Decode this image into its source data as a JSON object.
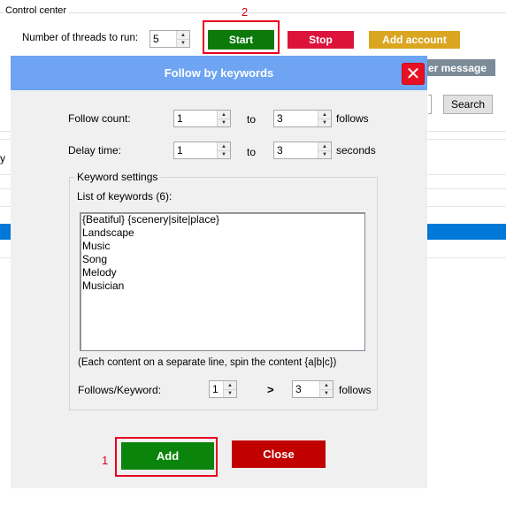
{
  "control_center": {
    "title": "Control center",
    "threads_label": "Number of threads to run:",
    "threads_value": "5",
    "start_label": "Start",
    "stop_label": "Stop",
    "add_account_label": "Add account",
    "message_button_label": "er message",
    "search_label": "Search",
    "background_fragment": "y"
  },
  "annotations": {
    "step_2": "2",
    "step_1": "1"
  },
  "dialog": {
    "title": "Follow by keywords",
    "follow_count": {
      "label": "Follow count:",
      "from": "1",
      "to_label": "to",
      "to": "3",
      "unit": "follows"
    },
    "delay_time": {
      "label": "Delay time:",
      "from": "1",
      "to_label": "to",
      "to": "3",
      "unit": "seconds"
    },
    "keyword_settings": {
      "legend": "Keyword settings",
      "list_label": "List of keywords (6):",
      "keywords": [
        "{Beatiful} {scenery|site|place}",
        "Landscape",
        "Music",
        "Song",
        "Melody",
        "Musician"
      ],
      "hint": "(Each content on a separate line, spin the content {a|b|c})",
      "follows_per_keyword": {
        "label": "Follows/Keyword:",
        "from": "1",
        "op": ">",
        "to": "3",
        "unit": "follows"
      }
    },
    "add_label": "Add",
    "close_label": "Close"
  },
  "colors": {
    "start": "#0b7a0b",
    "stop": "#dc143c",
    "add_account": "#daa520",
    "dialog_title_bar": "#6ea4f2",
    "close_x": "#e81123",
    "add": "#0b840b",
    "close": "#c10000",
    "annotation": "#e8001f"
  }
}
